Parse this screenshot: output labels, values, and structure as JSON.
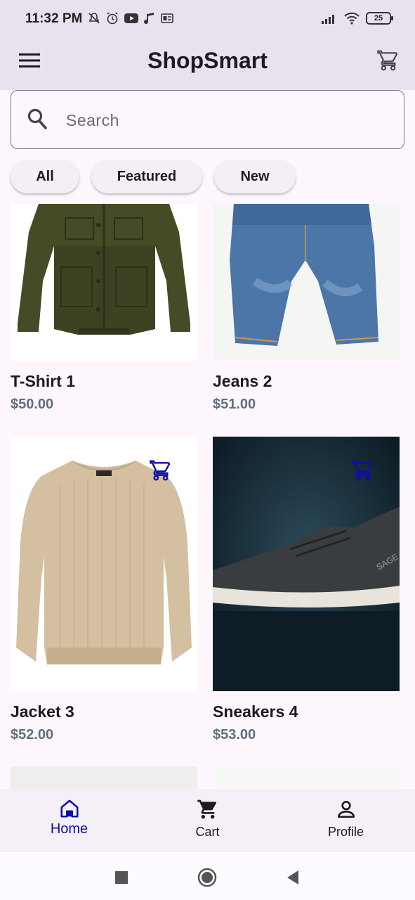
{
  "status_bar": {
    "time": "11:32 PM",
    "battery": "25"
  },
  "app_bar": {
    "title": "ShopSmart",
    "menu_icon": "menu-icon",
    "cart_icon": "cart-icon"
  },
  "search": {
    "placeholder": "Search",
    "value": "",
    "icon": "search-icon"
  },
  "chips": [
    {
      "label": "All"
    },
    {
      "label": "Featured"
    },
    {
      "label": "New"
    }
  ],
  "products": [
    {
      "name": "T-Shirt 1",
      "price": "$50.00",
      "image": "green-jacket"
    },
    {
      "name": "Jeans 2",
      "price": "$51.00",
      "image": "blue-jeans"
    },
    {
      "name": "Jacket 3",
      "price": "$52.00",
      "image": "beige-sweater"
    },
    {
      "name": "Sneakers 4",
      "price": "$53.00",
      "image": "dark-sneaker"
    }
  ],
  "bottom_nav": [
    {
      "label": "Home",
      "icon": "home-icon",
      "active": true
    },
    {
      "label": "Cart",
      "icon": "cart-icon",
      "active": false
    },
    {
      "label": "Profile",
      "icon": "person-icon",
      "active": false
    }
  ],
  "colors": {
    "accent": "#0d0da8",
    "app_bar_bg": "#e8e2ef",
    "price": "#5f6f80"
  }
}
